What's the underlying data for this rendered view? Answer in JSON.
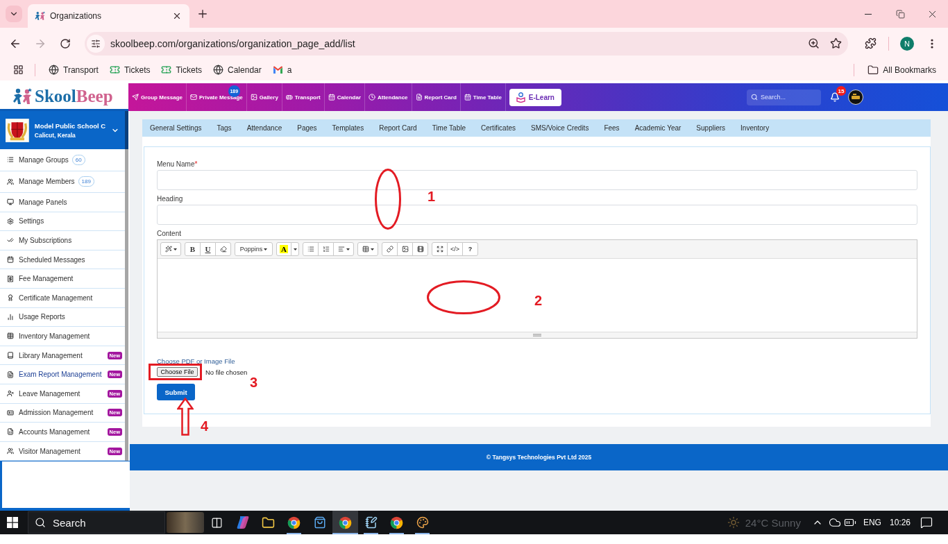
{
  "browser": {
    "tab": {
      "title": "Organizations"
    },
    "url": "skoolbeep.com/organizations/organization_page_add/list",
    "profile": "N",
    "bookmarks": [
      {
        "kind": "web",
        "label": "Transport"
      },
      {
        "kind": "tickets",
        "label": "Tickets"
      },
      {
        "kind": "tickets",
        "label": "Tickets"
      },
      {
        "kind": "web",
        "label": "Calendar"
      },
      {
        "kind": "mail",
        "label": "a"
      }
    ],
    "all_bookmarks": "All Bookmarks"
  },
  "header": {
    "logo": {
      "first": "Skool",
      "second": "Beep"
    },
    "nav": [
      {
        "label": "Group Message"
      },
      {
        "label": "Private Message",
        "badge": "189"
      },
      {
        "label": "Gallery"
      },
      {
        "label": "Transport"
      },
      {
        "label": "Calendar"
      },
      {
        "label": "Attendance"
      },
      {
        "label": "Report Card"
      },
      {
        "label": "Time Table"
      }
    ],
    "elearn": "E-Learn",
    "search": {
      "placeholder": "Search..."
    },
    "notification_count": "15"
  },
  "sidebar": {
    "school": {
      "name": "Model Public School C",
      "location": "Calicut, Kerala"
    },
    "items": [
      {
        "label": "Manage Groups",
        "count": "60",
        "selected": false
      },
      {
        "label": "Manage Members",
        "count": "189",
        "selected": false
      },
      {
        "label": "Manage Panels",
        "selected": false
      },
      {
        "label": "Settings",
        "selected": false
      },
      {
        "label": "My Subscriptions",
        "selected": false
      },
      {
        "label": "Scheduled Messages",
        "selected": false
      },
      {
        "label": "Fee Management",
        "selected": false
      },
      {
        "label": "Certificate Management",
        "selected": false
      },
      {
        "label": "Usage Reports",
        "selected": false
      },
      {
        "label": "Inventory Management",
        "selected": false
      },
      {
        "label": "Library Management",
        "badge": "New",
        "selected": false
      },
      {
        "label": "Exam Report Management",
        "badge": "New",
        "selected": true
      },
      {
        "label": "Leave Management",
        "badge": "New",
        "selected": false
      },
      {
        "label": "Admission Management",
        "badge": "New",
        "selected": false
      },
      {
        "label": "Accounts Management",
        "badge": "New",
        "selected": false
      },
      {
        "label": "Visitor Management",
        "badge": "New",
        "selected": false
      }
    ]
  },
  "tabs": [
    {
      "label": "General Settings",
      "selected": false
    },
    {
      "label": "Tags",
      "selected": false
    },
    {
      "label": "Attendance",
      "selected": false
    },
    {
      "label": "Pages",
      "selected": false
    },
    {
      "label": "Templates",
      "selected": false
    },
    {
      "label": "Report Card",
      "selected": false
    },
    {
      "label": "Time Table",
      "selected": false
    },
    {
      "label": "Certificates",
      "selected": false
    },
    {
      "label": "SMS/Voice Credits",
      "selected": false
    },
    {
      "label": "Fees",
      "selected": false
    },
    {
      "label": "Academic Year",
      "selected": false
    },
    {
      "label": "Suppliers",
      "selected": false
    },
    {
      "label": "Inventory",
      "selected": false
    }
  ],
  "form": {
    "fields": [
      {
        "label": "Menu Name",
        "required_mark": "*"
      },
      {
        "label": "Heading"
      }
    ],
    "content": {
      "label": "Content",
      "toolbar": [
        {
          "buttons": [
            {
              "kind": "icon",
              "caret": true
            }
          ]
        },
        {
          "buttons": [
            {
              "kind": "bold",
              "label": "B"
            },
            {
              "kind": "underline",
              "label": "U"
            },
            {
              "kind": "icon"
            }
          ]
        },
        {
          "buttons": [
            {
              "kind": "dropdown",
              "label": "Poppins"
            }
          ]
        },
        {
          "buttons": [
            {
              "kind": "color",
              "label": "A"
            },
            {
              "kind": "caret"
            }
          ]
        },
        {
          "buttons": [
            {
              "kind": "icon"
            },
            {
              "kind": "icon"
            },
            {
              "kind": "icon",
              "caret": true
            }
          ]
        },
        {
          "buttons": [
            {
              "kind": "icon",
              "caret": true
            }
          ]
        },
        {
          "buttons": [
            {
              "kind": "icon"
            },
            {
              "kind": "icon"
            },
            {
              "kind": "icon"
            }
          ]
        },
        {
          "buttons": [
            {
              "kind": "icon"
            },
            {
              "kind": "text",
              "label": "</>"
            },
            {
              "kind": "text",
              "label": "?"
            }
          ]
        }
      ]
    },
    "file": {
      "label": "Choose PDF or Image File",
      "button": "Choose File",
      "status": "No file chosen"
    },
    "submit": "Submit"
  },
  "annotations": [
    {
      "kind": "ellipse",
      "number": "1"
    },
    {
      "kind": "ellipse",
      "number": "2"
    },
    {
      "kind": "rectangle",
      "number": "3"
    },
    {
      "kind": "arrow",
      "number": "4"
    }
  ],
  "footer": "© Tangsys Technologies Pvt Ltd 2025",
  "taskbar": {
    "search": {
      "placeholder": "Search"
    },
    "apps": [
      {
        "running": false,
        "selected": false
      },
      {
        "running": false,
        "selected": false
      },
      {
        "running": false,
        "selected": false
      },
      {
        "running": true,
        "selected": false
      },
      {
        "running": false,
        "selected": false
      },
      {
        "running": true,
        "selected": true
      },
      {
        "running": true,
        "selected": false
      },
      {
        "running": true,
        "selected": false
      },
      {
        "running": true,
        "selected": false
      }
    ],
    "weather": "24°C Sunny",
    "language": "ENG",
    "time": "10:26"
  }
}
